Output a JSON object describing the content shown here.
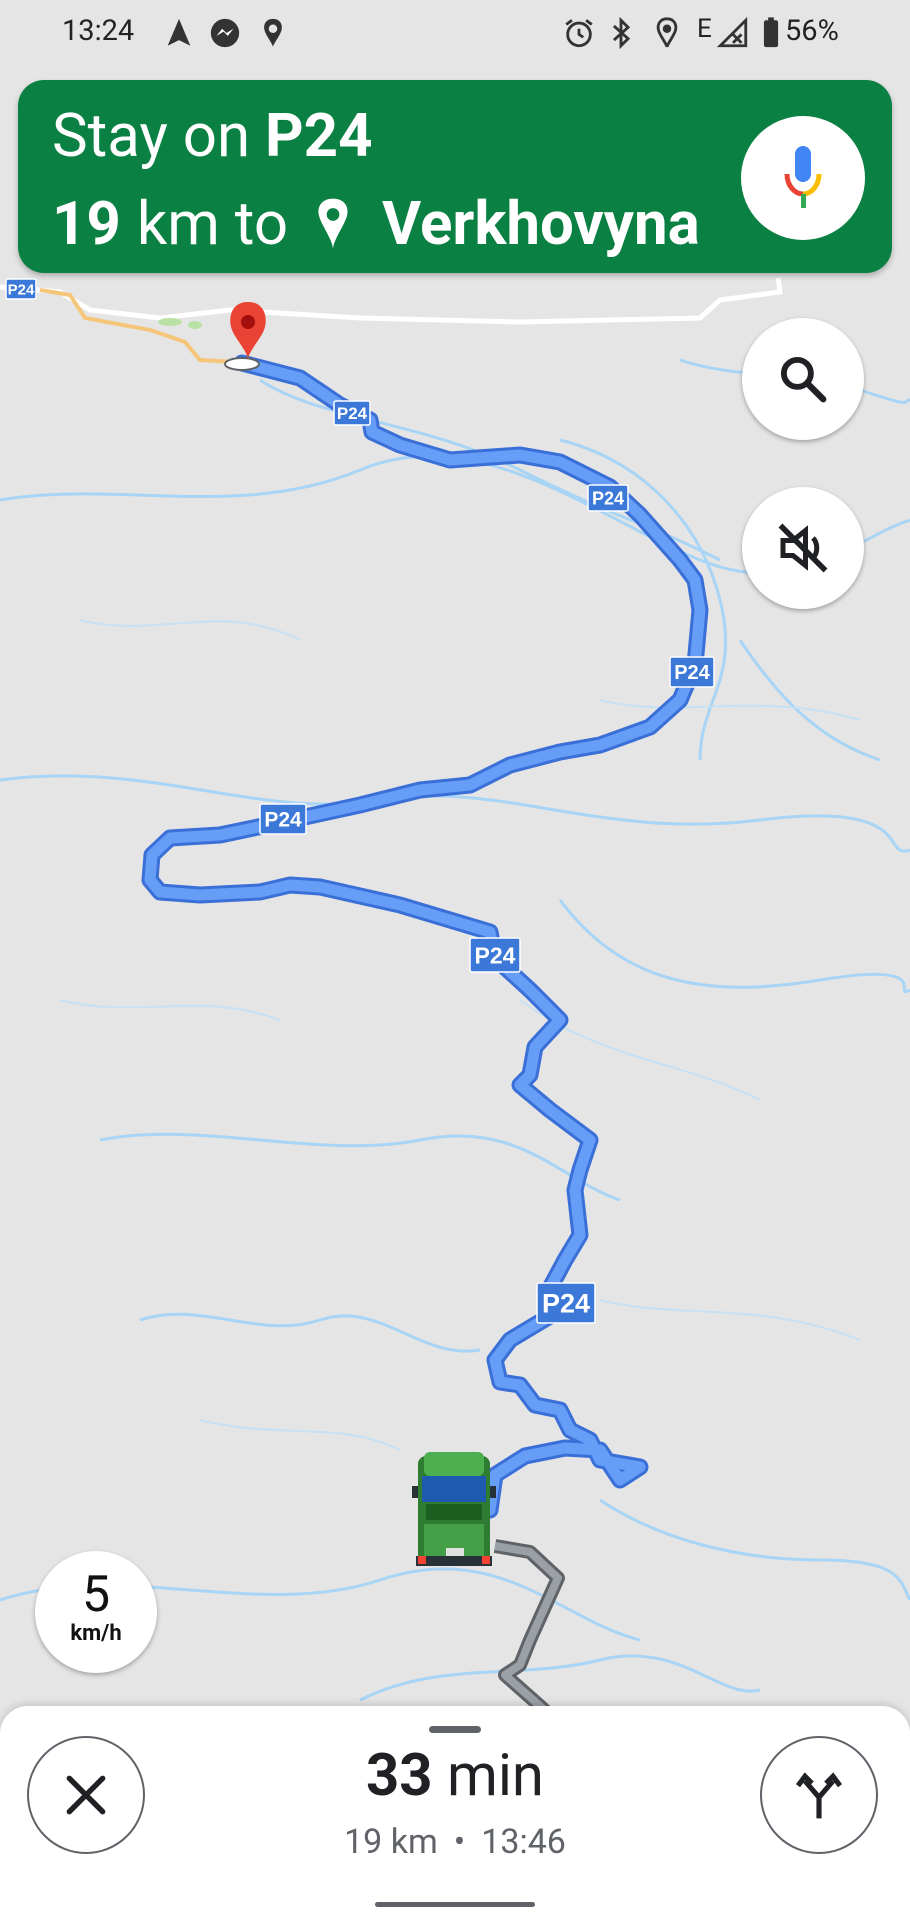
{
  "status_bar": {
    "time": "13:24",
    "network": "E",
    "battery": "56%",
    "icons": [
      "navigation-arrow-icon",
      "messenger-icon",
      "location-pin-icon",
      "alarm-icon",
      "bluetooth-icon",
      "location-icon",
      "signal-icon",
      "battery-icon"
    ]
  },
  "banner": {
    "instruction_prefix": "Stay on",
    "road": "P24",
    "distance_value": "19",
    "distance_unit": "km to",
    "destination": "Verkhovyna",
    "color": "#0b8043"
  },
  "map": {
    "road_shield": "P24",
    "route_color": "#4285f4",
    "shield_color": "#3b78d8",
    "destination_pin_color": "#ea4335"
  },
  "speed": {
    "value": "5",
    "unit": "km/h"
  },
  "trip": {
    "duration_value": "33",
    "duration_unit": "min",
    "distance": "19 km",
    "separator": "•",
    "arrival": "13:46"
  }
}
